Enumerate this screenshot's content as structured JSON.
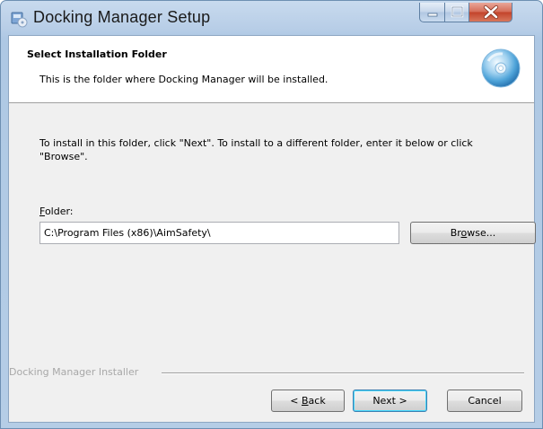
{
  "window": {
    "title": "Docking Manager Setup",
    "controls": {
      "minimize": "minimize",
      "maximize": "maximize",
      "close": "close"
    }
  },
  "header": {
    "title": "Select Installation Folder",
    "subtitle": "This is the folder where Docking Manager will be installed."
  },
  "body": {
    "instruction": "To install in this folder, click \"Next\". To install to a different folder, enter it below or click \"Browse\".",
    "folder_label_access": "F",
    "folder_label_rest": "older:",
    "folder_value": "C:\\Program Files (x86)\\AimSafety\\",
    "browse_pre": "Br",
    "browse_access": "o",
    "browse_post": "wse..."
  },
  "footer": {
    "installer_label": "Docking Manager Installer",
    "back_pre": "< ",
    "back_access": "B",
    "back_post": "ack",
    "next_label": "Next >",
    "cancel_label": "Cancel"
  },
  "icons": {
    "app": "setup-app-icon",
    "header": "cd-disc-icon"
  },
  "colors": {
    "titlebar": "#b8cee7",
    "close_button": "#c2432a",
    "default_button_border": "#3c7fb1"
  }
}
